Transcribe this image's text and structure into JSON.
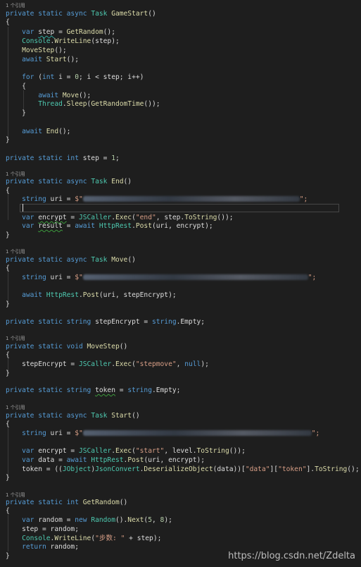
{
  "lens": {
    "references": "1 个引用"
  },
  "code": {
    "gamestart": {
      "sig": {
        "mods": "private static async",
        "ret": "Task",
        "name": "GameStart",
        "params": "()"
      },
      "open": "{",
      "l1": {
        "kw": "var",
        "name": "step",
        "eq": " = ",
        "call": "GetRandom",
        "end": "();"
      },
      "l2": {
        "cls": "Console",
        "dot": ".",
        "fn": "WriteLine",
        "args": "(step);"
      },
      "l3": {
        "call": "MoveStep",
        "end": "();"
      },
      "l4": {
        "kw": "await",
        "call": "Start",
        "end": "();"
      },
      "l5": {
        "kw": "for",
        "p1": " (",
        "kw2": "int",
        "p2": " i = ",
        "n0": "0",
        "p3": "; i < step; i++)"
      },
      "l6": "{",
      "l7": {
        "kw": "await",
        "call": "Move",
        "end": "();"
      },
      "l8": {
        "cls": "Thread",
        "dot": ".",
        "fn": "Sleep",
        "p1": "(",
        "fn2": "GetRandomTime",
        "p2": "());"
      },
      "l9": "}",
      "l10": {
        "kw": "await",
        "call": "End",
        "end": "();"
      },
      "close": "}"
    },
    "stepfield": {
      "mods": "private static",
      "ty": "int",
      "rest": " step = ",
      "num": "1",
      "end": ";"
    },
    "end": {
      "sig": {
        "mods": "private static async",
        "ret": "Task",
        "name": "End",
        "params": "()"
      },
      "open": "{",
      "l1": {
        "kw": "string",
        "rest": " uri = ",
        "str": "$\"",
        "tail": "\";"
      },
      "l2": {
        "kw": "var",
        "name": "encrypt",
        "eq": " = ",
        "cls": "JSCaller",
        "dot": ".",
        "fn": "Exec",
        "p1": "(",
        "s": "\"end\"",
        "p2": ", step.",
        "fn2": "ToString",
        "p3": "());"
      },
      "l3": {
        "kw": "var",
        "name": "result",
        "eq": " = ",
        "kw2": "await",
        "cls": "HttpRest",
        "dot": ".",
        "fn": "Post",
        "args": "(uri, encrypt);"
      },
      "close": "}"
    },
    "move": {
      "sig": {
        "mods": "private static async",
        "ret": "Task",
        "name": "Move",
        "params": "()"
      },
      "open": "{",
      "l1": {
        "kw": "string",
        "rest": " uri = ",
        "str": "$\"",
        "tail": "\";"
      },
      "l2": {
        "kw": "await",
        "cls": "HttpRest",
        "dot": ".",
        "fn": "Post",
        "args": "(uri, stepEncrypt);"
      },
      "close": "}"
    },
    "stepencryptfield": {
      "mods": "private static",
      "ty": "string",
      "rest": " stepEncrypt = ",
      "ty2": "string",
      "tail": ".Empty;"
    },
    "movestep": {
      "sig": {
        "mods": "private static void",
        "name": "MoveStep",
        "params": "()"
      },
      "open": "{",
      "l1": {
        "rest": "stepEncrypt = ",
        "cls": "JSCaller",
        "dot": ".",
        "fn": "Exec",
        "p1": "(",
        "s": "\"stepmove\"",
        "p2": ", ",
        "kw": "null",
        "p3": ");"
      },
      "close": "}"
    },
    "tokenfield": {
      "mods": "private static",
      "ty": "string",
      "name": "token",
      "eq": " = ",
      "ty2": "string",
      "tail": ".Empty;"
    },
    "start": {
      "sig": {
        "mods": "private static async",
        "ret": "Task",
        "name": "Start",
        "params": "()"
      },
      "open": "{",
      "l1": {
        "kw": "string",
        "rest": " uri = ",
        "str": "$\"",
        "tail": "\";"
      },
      "l2": {
        "kw": "var",
        "rest": " encrypt = ",
        "cls": "JSCaller",
        "dot": ".",
        "fn": "Exec",
        "p1": "(",
        "s": "\"start\"",
        "p2": ", level.",
        "fn2": "ToString",
        "p3": "());"
      },
      "l3": {
        "kw": "var",
        "rest": " data = ",
        "kw2": "await",
        "cls": "HttpRest",
        "dot": ".",
        "fn": "Post",
        "args": "(uri, encrypt);"
      },
      "l4": {
        "p1": "token = ((",
        "cls": "JObject",
        "p2": ")",
        "cls2": "JsonConvert",
        "dot": ".",
        "fn": "DeserializeObject",
        "p3": "(data))[",
        "s1": "\"data\"",
        "p4": "][",
        "s2": "\"token\"",
        "p5": "].",
        "fn2": "ToString",
        "p6": "();"
      },
      "close": "}"
    },
    "getrandom": {
      "sig": {
        "mods": "private static",
        "ret": "int",
        "name": "GetRandom",
        "params": "()"
      },
      "open": "{",
      "l1": {
        "kw": "var",
        "rest": " random = ",
        "kw2": "new",
        "cls": "Random",
        "p1": "().",
        "fn": "Next",
        "p2": "(",
        "n1": "5",
        "p3": ", ",
        "n2": "8",
        "p4": ");"
      },
      "l2": "step = random;",
      "l3": {
        "cls": "Console",
        "dot": ".",
        "fn": "WriteLine",
        "p1": "(",
        "s": "\"步数: \"",
        "p2": " + step);"
      },
      "l4": {
        "kw": "return",
        "rest": " random;"
      },
      "close": "}"
    }
  },
  "watermark": "https://blog.csdn.net/Zdelta"
}
